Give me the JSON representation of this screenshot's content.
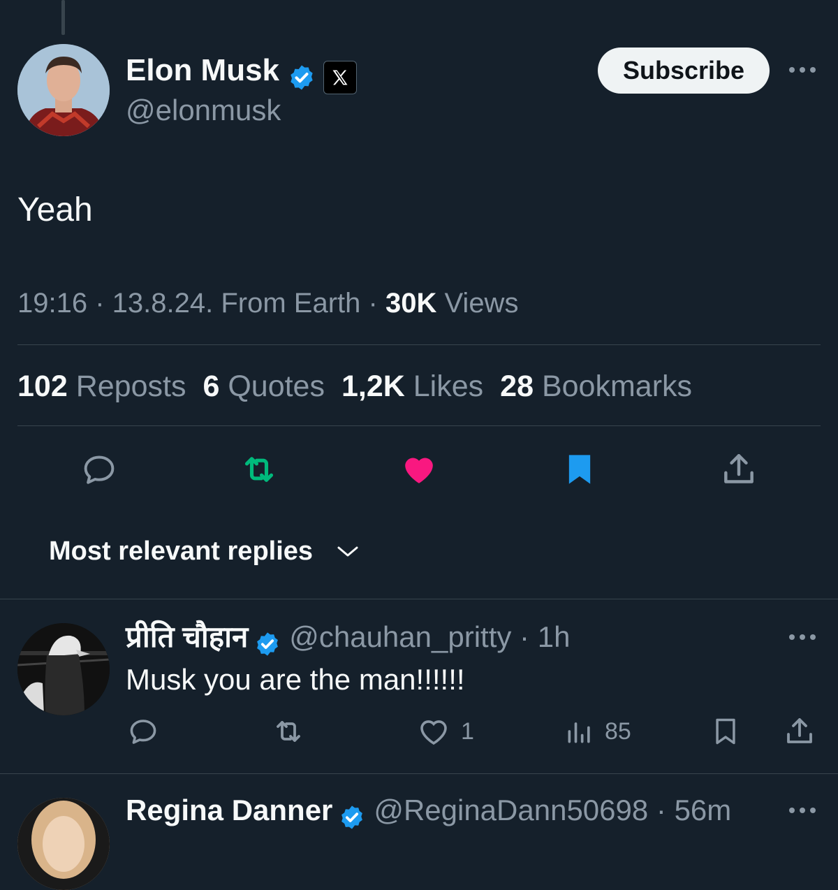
{
  "tweet": {
    "author_name": "Elon Musk",
    "author_handle": "@elonmusk",
    "subscribe_label": "Subscribe",
    "text": "Yeah",
    "time": "19:16",
    "date": "13.8.24.",
    "source": "From Earth",
    "views_count": "30K",
    "views_label": "Views",
    "stats": [
      {
        "count": "102",
        "label": "Reposts"
      },
      {
        "count": "6",
        "label": "Quotes"
      },
      {
        "count": "1,2K",
        "label": "Likes"
      },
      {
        "count": "28",
        "label": "Bookmarks"
      }
    ],
    "actions": {
      "reply": "reply-icon",
      "repost": "repost-icon",
      "like": "heart-icon",
      "bookmark": "bookmark-icon",
      "share": "share-icon"
    },
    "colors": {
      "repost_active": "#00ba7c",
      "like_active": "#f91880",
      "bookmark_active": "#1d9bf0",
      "verified": "#1d9bf0",
      "background": "#15202b"
    }
  },
  "sort": {
    "label": "Most relevant replies"
  },
  "replies": [
    {
      "name": "प्रीति चौहान",
      "handle": "@chauhan_pritty",
      "time": "1h",
      "text": "Musk you are the man!!!!!!",
      "likes": "1",
      "views": "85"
    },
    {
      "name": "Regina Danner",
      "handle": "@ReginaDann50698",
      "time": "56m"
    }
  ]
}
